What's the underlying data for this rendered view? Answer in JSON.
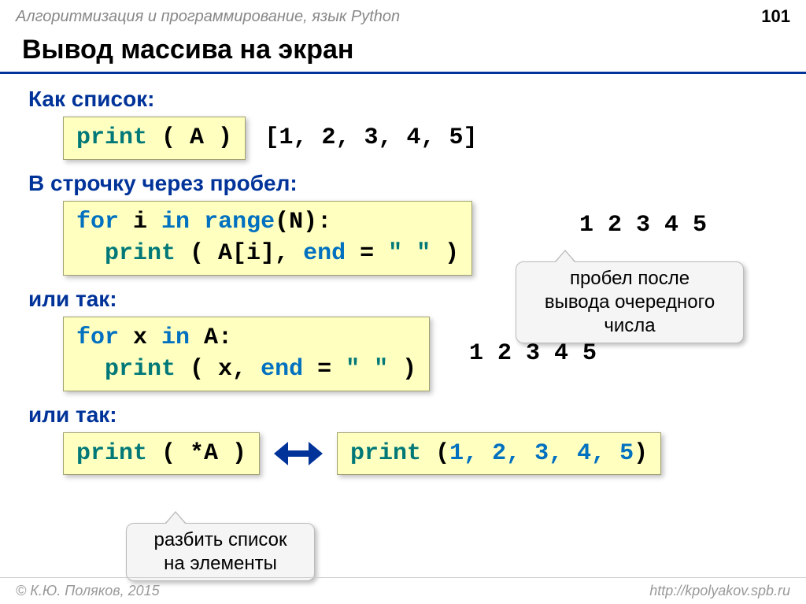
{
  "header": {
    "subject": "Алгоритмизация и программирование, язык Python",
    "page_number": "101"
  },
  "title": "Вывод массива на экран",
  "sections": {
    "as_list": {
      "heading": "Как список:",
      "code": {
        "print": "print",
        "rest": " ( A )"
      },
      "output": "[1, 2, 3, 4, 5]"
    },
    "via_space": {
      "heading": "В строчку через пробел:",
      "code_line1": {
        "for": "for",
        "mid1": " i ",
        "in": "in",
        "mid2": " ",
        "range": "range",
        "rest": "(N):"
      },
      "code_line2": {
        "indent": "  ",
        "print": "print",
        "mid": " ( A[i], ",
        "end": "end",
        "eq": " = ",
        "val": "\" \"",
        "tail": " )"
      },
      "output": "1 2 3 4 5",
      "callout": "пробел после\nвывода очередного\nчисла"
    },
    "or1": {
      "heading": "или так:",
      "code_line1": {
        "for": "for",
        "mid1": " x ",
        "in": "in",
        "rest": " A:"
      },
      "code_line2": {
        "indent": "  ",
        "print": "print",
        "mid": " ( x, ",
        "end": "end",
        "eq": " = ",
        "val": "\" \"",
        "tail": " )"
      },
      "output": "1 2 3 4 5"
    },
    "or2": {
      "heading": "или так:",
      "code_left": {
        "print": "print",
        "rest": " ( *A )"
      },
      "code_right": {
        "print": "print",
        "open": " (",
        "args": "1, 2, 3, 4, 5",
        "close": ")"
      },
      "callout": "разбить список\nна элементы"
    }
  },
  "footer": {
    "copyright": "© К.Ю. Поляков, 2015",
    "url": "http://kpolyakov.spb.ru"
  }
}
